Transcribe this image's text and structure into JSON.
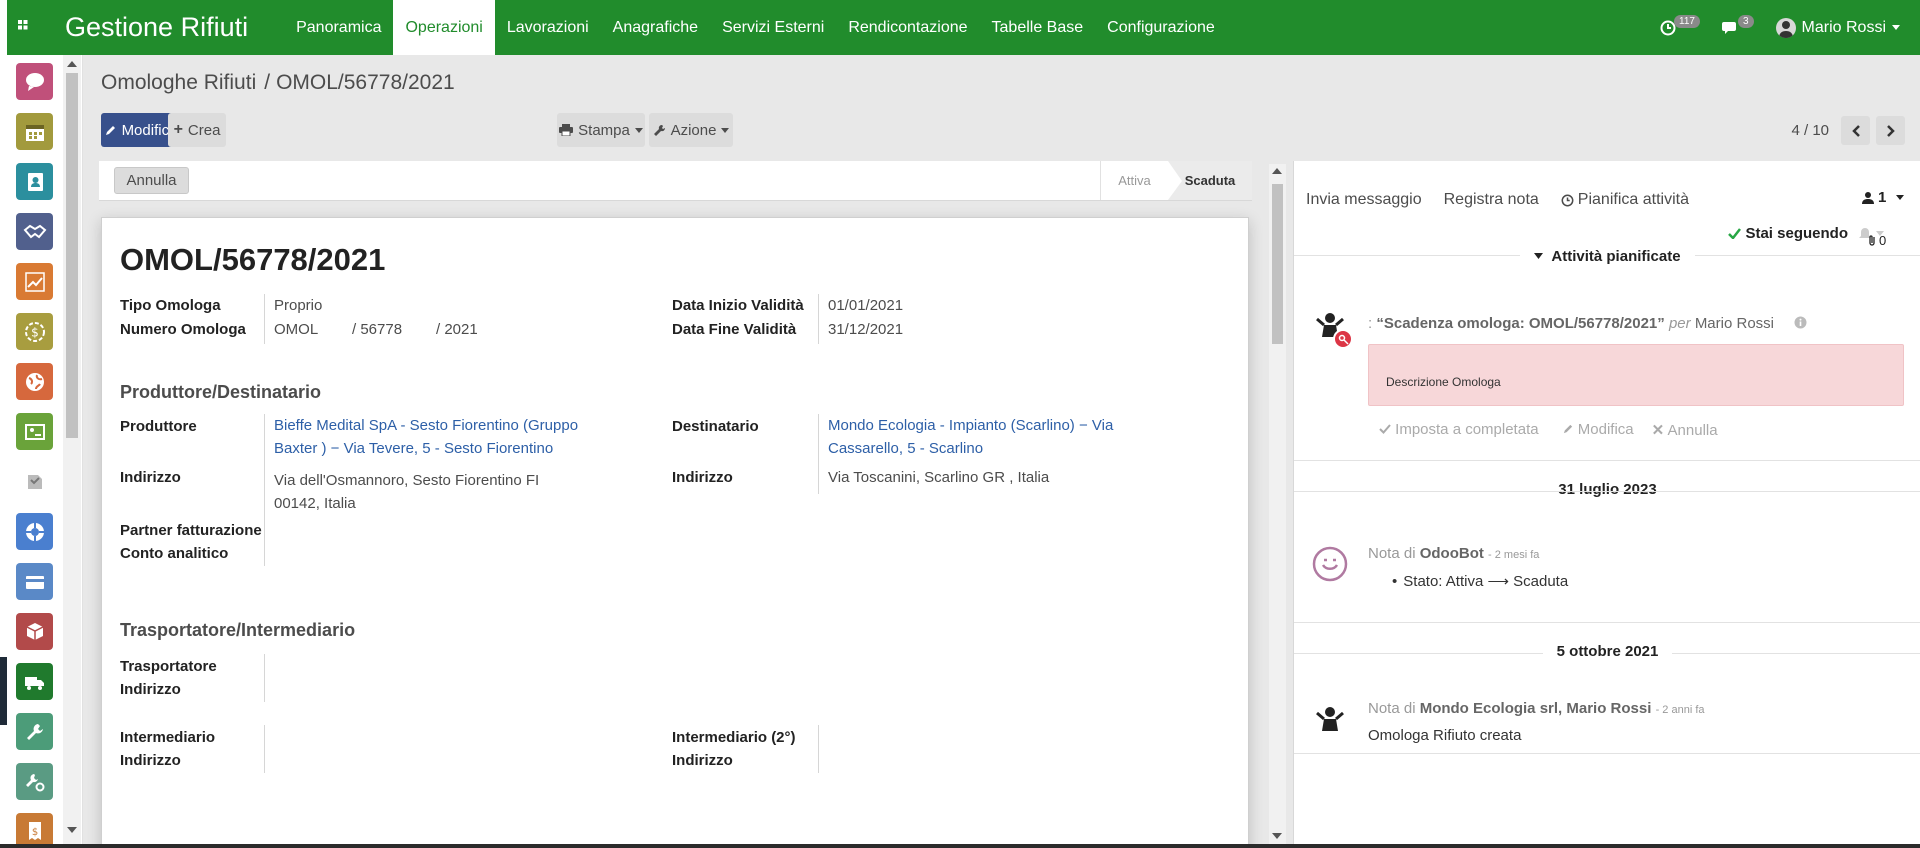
{
  "navbar": {
    "brand": "Gestione Rifiuti",
    "menu": [
      "Panoramica",
      "Operazioni",
      "Lavorazioni",
      "Anagrafiche",
      "Servizi Esterni",
      "Rendicontazione",
      "Tabelle Base",
      "Configurazione"
    ],
    "active_index": 1,
    "activity_count": "117",
    "message_count": "3",
    "user": "Mario Rossi"
  },
  "breadcrumb": {
    "parent": "Omologhe Rifiuti",
    "separator": "/",
    "current": "OMOL/56778/2021"
  },
  "toolbar": {
    "edit": "Modifica",
    "create": "Crea",
    "print": "Stampa",
    "action": "Azione"
  },
  "pager": {
    "value": "4 / 10"
  },
  "statusbar": {
    "cancel": "Annulla",
    "stages": [
      "Attiva",
      "Scaduta"
    ],
    "current_stage": "Scaduta"
  },
  "record": {
    "title": "OMOL/56778/2021",
    "tipo_label": "Tipo Omologa",
    "tipo_value": "Proprio",
    "numero_label": "Numero Omologa",
    "numero_prefix": "OMOL",
    "numero_mid": "/ 56778",
    "numero_year": "/ 2021",
    "inizio_label": "Data Inizio Validità",
    "inizio_value": "01/01/2021",
    "fine_label": "Data Fine Validità",
    "fine_value": "31/12/2021",
    "section_prod": "Produttore/Destinatario",
    "produttore_label": "Produttore",
    "produttore_line1": "Bieffe Medital SpA - Sesto Fiorentino (Gruppo",
    "produttore_line2": "Baxter ) − Via Tevere, 5 - Sesto Fiorentino",
    "destinatario_label": "Destinatario",
    "destinatario_line1": "Mondo Ecologia - Impianto (Scarlino) − Via",
    "destinatario_line2": "Cassarello, 5 - Scarlino",
    "indirizzo_label": "Indirizzo",
    "prod_indirizzo_line1": "Via dell'Osmannoro, Sesto Fiorentino FI",
    "prod_indirizzo_line2": "00142, Italia",
    "dest_indirizzo": "Via Toscanini, Scarlino GR , Italia",
    "partner_label": "Partner fatturazione",
    "conto_label": "Conto analitico",
    "section_trasp": "Trasportatore/Intermediario",
    "trasportatore_label": "Trasportatore",
    "intermediario_label": "Intermediario",
    "intermediario2_label": "Intermediario (2°)"
  },
  "chatter": {
    "send_message": "Invia messaggio",
    "log_note": "Registra nota",
    "schedule": "Pianifica attività",
    "followers_count": "1",
    "following": "Stai seguendo",
    "attachments_count": "0",
    "activities_header": "Attività pianificate",
    "activity_prefix": ":",
    "activity_title": "“Scadenza omologa: OMOL/56778/2021”",
    "activity_per": "per",
    "activity_user": "Mario Rossi",
    "activity_desc": "Descrizione Omologa",
    "mark_done": "Imposta a completata",
    "edit": "Modifica",
    "cancel": "Annulla",
    "date1": "31 luglio 2023",
    "msg1_prefix": "Nota di",
    "msg1_author": "OdooBot",
    "msg1_time": "- 2 mesi fa",
    "msg1_body": "Stato: Attiva ⟶ Scaduta",
    "date2": "5 ottobre 2021",
    "msg2_prefix": "Nota di",
    "msg2_author": "Mondo Ecologia srl, Mario Rossi",
    "msg2_time": "- 2 anni fa",
    "msg2_body": "Omologa Rifiuto creata"
  },
  "colors": {
    "navbar": "#218c2c",
    "primary": "#37508c",
    "link": "#2d5fa7",
    "activity_bg": "#f7d7d9"
  },
  "sidebar_apps": [
    "discuss-icon",
    "calendar-icon",
    "contacts-icon",
    "crm-icon",
    "sales-icon",
    "invoicing-icon",
    "website-icon",
    "maps-icon",
    "documents-icon",
    "helpdesk-icon",
    "payment-icon",
    "inventory-icon",
    "fleet-icon",
    "tools-icon",
    "settings-icon",
    "expenses-icon"
  ]
}
